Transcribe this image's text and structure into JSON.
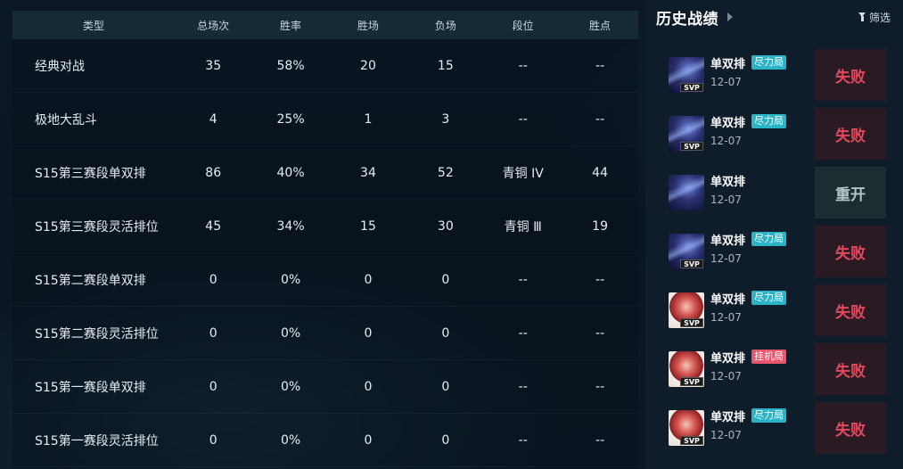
{
  "stats": {
    "headers": [
      "类型",
      "总场次",
      "胜率",
      "胜场",
      "负场",
      "段位",
      "胜点"
    ],
    "rows": [
      [
        "经典对战",
        "35",
        "58%",
        "20",
        "15",
        "--",
        "--"
      ],
      [
        "极地大乱斗",
        "4",
        "25%",
        "1",
        "3",
        "--",
        "--"
      ],
      [
        "S15第三赛段单双排",
        "86",
        "40%",
        "34",
        "52",
        "青铜 IV",
        "44"
      ],
      [
        "S15第三赛段灵活排位",
        "45",
        "34%",
        "15",
        "30",
        "青铜 Ⅲ",
        "19"
      ],
      [
        "S15第二赛段单双排",
        "0",
        "0%",
        "0",
        "0",
        "--",
        "--"
      ],
      [
        "S15第二赛段灵活排位",
        "0",
        "0%",
        "0",
        "0",
        "--",
        "--"
      ],
      [
        "S15第一赛段单双排",
        "0",
        "0%",
        "0",
        "0",
        "--",
        "--"
      ],
      [
        "S15第一赛段灵活排位",
        "0",
        "0%",
        "0",
        "0",
        "--",
        "--"
      ]
    ]
  },
  "history": {
    "title": "历史战绩",
    "filter_label": "筛选",
    "matches": [
      {
        "mode": "单双排",
        "tag": "尽力局",
        "tag_color": "#2bb3c6",
        "date": "12-07",
        "result": "失败",
        "svp": "SVP",
        "avatar": "dark-champion-portrait"
      },
      {
        "mode": "单双排",
        "tag": "尽力局",
        "tag_color": "#2bb3c6",
        "date": "12-07",
        "result": "失败",
        "svp": "SVP",
        "avatar": "dark-champion-portrait"
      },
      {
        "mode": "单双排",
        "tag": "",
        "tag_color": "",
        "date": "12-07",
        "result": "重开",
        "svp": "",
        "avatar": "dark-champion-portrait"
      },
      {
        "mode": "单双排",
        "tag": "尽力局",
        "tag_color": "#2bb3c6",
        "date": "12-07",
        "result": "失败",
        "svp": "SVP",
        "avatar": "dark-champion-portrait"
      },
      {
        "mode": "单双排",
        "tag": "尽力局",
        "tag_color": "#2bb3c6",
        "date": "12-07",
        "result": "失败",
        "svp": "SVP",
        "avatar": "red-champion-portrait"
      },
      {
        "mode": "单双排",
        "tag": "挂机局",
        "tag_color": "#e7566d",
        "date": "12-07",
        "result": "失败",
        "svp": "SVP",
        "avatar": "red-champion-portrait"
      },
      {
        "mode": "单双排",
        "tag": "尽力局",
        "tag_color": "#2bb3c6",
        "date": "12-07",
        "result": "失败",
        "svp": "SVP",
        "avatar": "red-champion-portrait"
      }
    ]
  },
  "colors": {
    "lose": "#e3485c",
    "redo": "#b7c5c9",
    "tag_teal": "#2bb3c6",
    "tag_pink": "#e7566d"
  }
}
